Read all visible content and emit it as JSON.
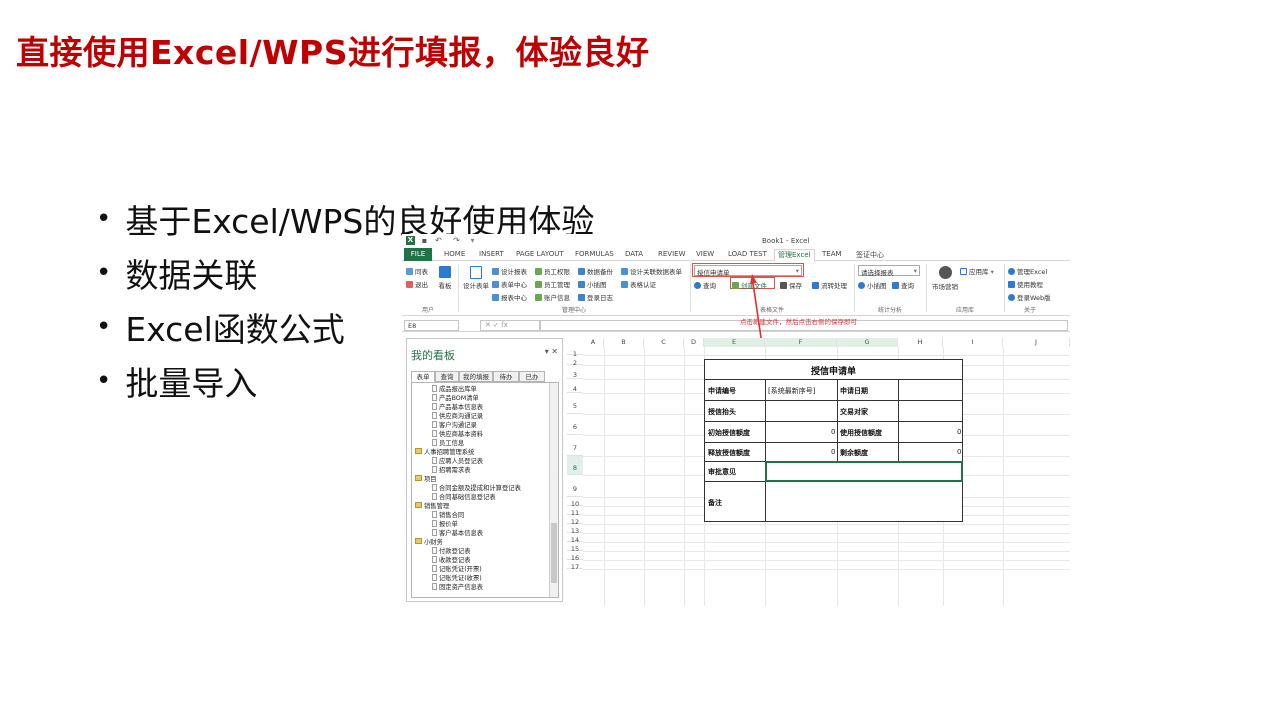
{
  "slide": {
    "title": "直接使用Excel/WPS进行填报，体验良好",
    "bullets": [
      "基于Excel/WPS的良好使用体验",
      "数据关联",
      "Excel函数公式",
      "批量导入"
    ]
  },
  "excel": {
    "window_title": "Book1 - Excel",
    "tabs": [
      "FILE",
      "HOME",
      "INSERT",
      "PAGE LAYOUT",
      "FORMULAS",
      "DATA",
      "REVIEW",
      "VIEW",
      "LOAD TEST",
      "管理Excel",
      "TEAM",
      "签证中心"
    ],
    "ribbon": {
      "user_group": {
        "items": [
          "同表",
          "退出",
          "看板"
        ],
        "label": "用户"
      },
      "manage_group": {
        "items": [
          "设计表单",
          "设计报表",
          "表单中心",
          "报表中心",
          "员工权限",
          "员工管理",
          "账户信息",
          "数据备份",
          "小插图",
          "登录日志",
          "设计关联数据表单",
          "表格认证"
        ],
        "label": "管理中心"
      },
      "file_group": {
        "combo_value": "授信申请单",
        "items": [
          "查询",
          "创建文件",
          "保存",
          "流转处理"
        ],
        "label": "表格文件"
      },
      "stats_group": {
        "combo_value": "请选择报表",
        "items": [
          "小插图",
          "查询"
        ],
        "label": "统计分析"
      },
      "app_group": {
        "items": [
          "市场营销",
          "应用库"
        ],
        "label": "应用库"
      },
      "about_group": {
        "items": [
          "管理Excel",
          "使用教程",
          "登录Web版"
        ],
        "label": "关于"
      }
    },
    "annotation": "点击新建文件，然后点击右侧的保存即可",
    "name_box": "E8",
    "fx_buttons": "✕ ✓ fx",
    "pane": {
      "title": "我的看板",
      "tabs": [
        "表单",
        "查询",
        "我的填报",
        "待办",
        "已办"
      ],
      "tree": [
        {
          "label": "成品报出库单",
          "level": 2
        },
        {
          "label": "产品BOM清单",
          "level": 2
        },
        {
          "label": "产品基本信息表",
          "level": 2
        },
        {
          "label": "供应商沟通记录",
          "level": 2
        },
        {
          "label": "客户沟通记录",
          "level": 2
        },
        {
          "label": "供应商基本资料",
          "level": 2
        },
        {
          "label": "员工信息",
          "level": 2
        },
        {
          "label": "人事招聘管理系统",
          "level": 1
        },
        {
          "label": "应聘人员登记表",
          "level": 2
        },
        {
          "label": "招聘需求表",
          "level": 2
        },
        {
          "label": "项目",
          "level": 1
        },
        {
          "label": "合同金额及提成和计算登记表",
          "level": 2
        },
        {
          "label": "合同基础信息登记表",
          "level": 2
        },
        {
          "label": "销售管理",
          "level": 1
        },
        {
          "label": "销售合同",
          "level": 2
        },
        {
          "label": "报价单",
          "level": 2
        },
        {
          "label": "客户基本信息表",
          "level": 2
        },
        {
          "label": "小财务",
          "level": 1
        },
        {
          "label": "付款登记表",
          "level": 2
        },
        {
          "label": "收款登记表",
          "level": 2
        },
        {
          "label": "记账凭证(开票)",
          "level": 2
        },
        {
          "label": "记账凭证(收票)",
          "level": 2
        },
        {
          "label": "固定资产信息表",
          "level": 2
        }
      ]
    },
    "columns": [
      "A",
      "B",
      "C",
      "D",
      "E",
      "F",
      "G",
      "H",
      "I",
      "J"
    ],
    "rows": [
      "1",
      "2",
      "3",
      "4",
      "5",
      "6",
      "7",
      "8",
      "9",
      "10",
      "11",
      "12",
      "13",
      "14",
      "15",
      "16",
      "17"
    ],
    "form": {
      "title": "授信申请单",
      "apply_no_label": "申请编号",
      "apply_no_value": "[系统最新序号]",
      "apply_date_label": "申请日期",
      "credit_head_label": "授信抬头",
      "counterparty_label": "交易对家",
      "initial_credit_label": "初始授信额度",
      "initial_credit_value": "0",
      "used_credit_label": "使用授信额度",
      "used_credit_value": "0",
      "released_credit_label": "释放授信额度",
      "released_credit_value": "0",
      "remaining_credit_label": "剩余额度",
      "remaining_credit_value": "0",
      "approval_label": "审批意见",
      "remarks_label": "备注"
    }
  }
}
